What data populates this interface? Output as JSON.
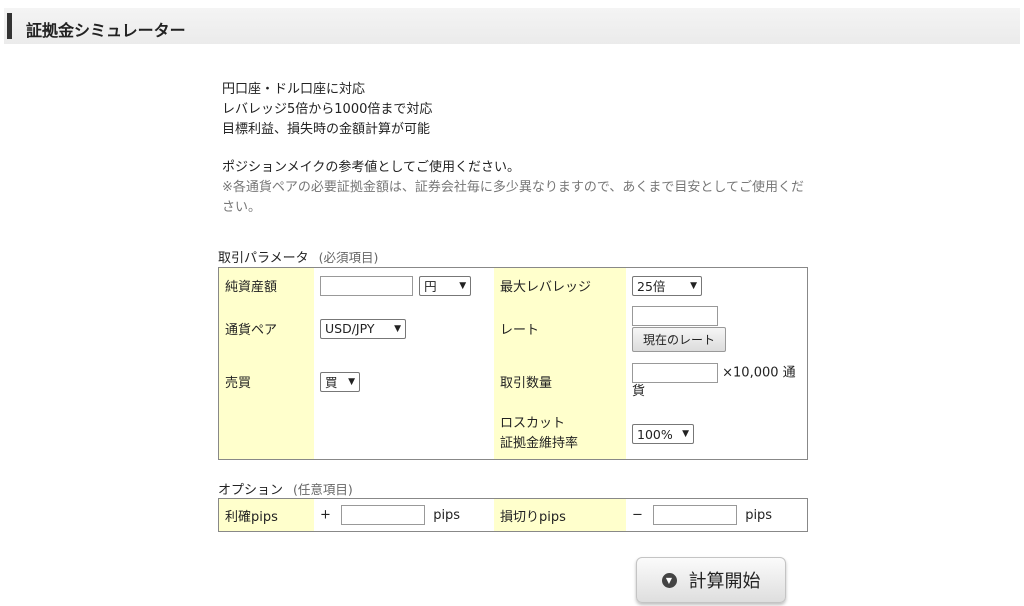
{
  "header": {
    "title": "証拠金シミュレーター"
  },
  "intro": {
    "lines": [
      "円口座・ドル口座に対応",
      "レバレッジ5倍から1000倍まで対応",
      "目標利益、損失時の金額計算が可能"
    ],
    "usage": "ポジションメイクの参考値としてご使用ください。",
    "note": "※各通貨ペアの必要証拠金額は、証券会社毎に多少異なりますので、あくまで目安としてご使用ください。"
  },
  "params": {
    "section_title": "取引パラメータ",
    "section_hint": "(必須項目)",
    "net_assets": {
      "label": "純資産額",
      "value": "",
      "unit_selected": "円"
    },
    "max_leverage": {
      "label": "最大レバレッジ",
      "selected": "25倍"
    },
    "currency_pair": {
      "label": "通貨ペア",
      "selected": "USD/JPY"
    },
    "rate": {
      "label": "レート",
      "value": "",
      "button": "現在のレート"
    },
    "side": {
      "label": "売買",
      "selected": "買"
    },
    "quantity": {
      "label": "取引数量",
      "value": "",
      "unit_suffix": "×10,000 通貨"
    },
    "losscut": {
      "label_line1": "ロスカット",
      "label_line2": "証拠金維持率",
      "selected": "100%"
    }
  },
  "options": {
    "section_title": "オプション",
    "section_hint": "(任意項目)",
    "take_profit": {
      "label": "利確pips",
      "sign": "+",
      "value": "",
      "unit": "pips"
    },
    "stop_loss": {
      "label": "損切りpips",
      "sign": "−",
      "value": "",
      "unit": "pips"
    }
  },
  "calc_button": {
    "label": "計算開始",
    "icon": "chevron-down-circle-icon"
  },
  "icons": {
    "select_arrow": "chevron-down-icon"
  },
  "colors": {
    "label_bg": "#ffffcc",
    "header_bg": "#eeeeee",
    "header_bar": "#333333"
  }
}
